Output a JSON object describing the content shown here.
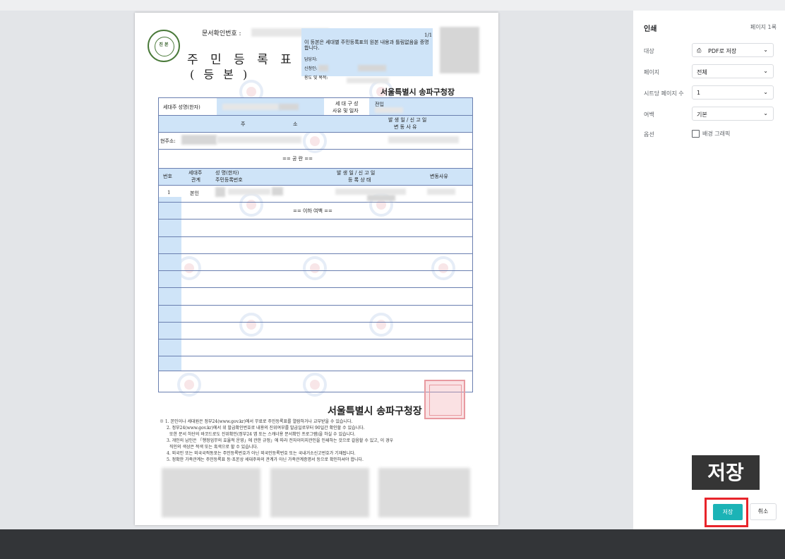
{
  "document": {
    "confirm_label": "문서확인번호 :",
    "page_counter": "1/1",
    "title": "주 민 등 록 표",
    "subtitle": "( 등          본 )",
    "seal_text": "진 본",
    "notice": "이 등본은 세대별 주민등록표의 원본 내용과 틀림없음을 증명합니다.",
    "clerk_label": "담당자:",
    "applicant_label": "신청인:",
    "purpose_label": "용도 및 목적:",
    "issuer": "서울특별시 송파구청장",
    "table": {
      "head_name": "세대주 성명(한자)",
      "head_compose": "세 대 구 성",
      "head_compose2": "사유 및 일자",
      "compose_value": "전입",
      "address_label": "주",
      "address_label2": "소",
      "date_label": "발 생 일 / 신 고 일",
      "change_label": "변 동 사 유",
      "current_address": "현주소:",
      "public_notice": "== 공 란 ==",
      "col_no": "번호",
      "col_relation": "세대주",
      "col_relation2": "관계",
      "col_name": "성 명(한자)",
      "col_id": "주민등록번호",
      "col_date": "발 생 일 / 신 고 일",
      "col_status": "등 록 상 태",
      "col_change": "변동사유",
      "row1_no": "1",
      "row1_relation": "본인",
      "end_marker": "== 이하 여백 =="
    },
    "footnotes": [
      "※ 1. 본인이나 세대원은 정부24(www.gov.kr)에서 무료로 주민등록표를 열람하거나 교부받을 수 있습니다.",
      "2. 정부24(www.gov.kr)에서 위 발급확인번호로 내용의 진위여부를 발급일로부터 90일간 확인할 수 있습니다.",
      "또한 문서 하단의 바코드로도 진위확인(정부24 앱 또는 스캐너용 문서확인 프로그램)을 하실 수 있습니다.",
      "3. 개인의 납인은 「행정업무의 효율적 운영」에 관한 규정」에 따라 전자이미지관인을 인쇄하는 것으로 갈음할 수 있고, 이 경우",
      "직인의 색상은 적색 또는 흑색으로 할 수 있습니다.",
      "4. 외국인 또는 외국국적동포는 주민등록번호가 아닌 외국인등록번호 또는 국내거소신고번호가 기재됩니다.",
      "5. 정확한 가족관계는 주민등록표 등·초본상 세대주와의 관계가 아닌 가족관계증명서 등으로 확인하셔야 합니다."
    ]
  },
  "panel": {
    "title": "인쇄",
    "page_count": "페이지 1록",
    "rows": [
      {
        "label": "대상",
        "value": "PDF로 저장",
        "icon": "printer-icon"
      },
      {
        "label": "페이지",
        "value": "전체"
      },
      {
        "label": "시트당 페이지 수",
        "value": "1"
      },
      {
        "label": "여백",
        "value": "기본"
      }
    ],
    "options_label": "옵션",
    "background_graphics": "배경 그래픽",
    "callout": "저장",
    "save_button": "저장",
    "cancel_button": "취소"
  },
  "colors": {
    "accent": "#1bb3b6",
    "highlight": "#e8242b",
    "table_blue": "#cfe4f8"
  }
}
